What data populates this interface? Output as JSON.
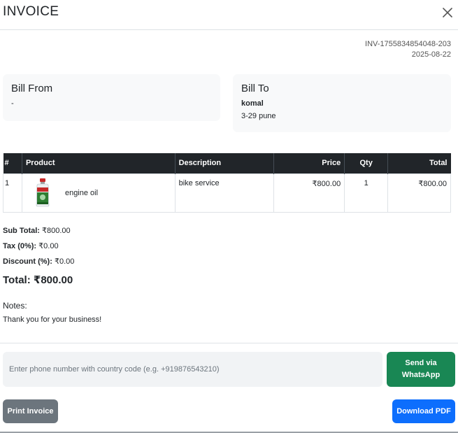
{
  "modal": {
    "title": "INVOICE",
    "close_icon": "close-icon"
  },
  "invoice": {
    "number": "INV-1755834854048-203",
    "date": "2025-08-22"
  },
  "bill_from": {
    "title": "Bill From",
    "value": "-"
  },
  "bill_to": {
    "title": "Bill To",
    "name": "komal",
    "address": "3-29 pune"
  },
  "table": {
    "headers": [
      "#",
      "Product",
      "Description",
      "Price",
      "Qty",
      "Total"
    ],
    "rows": [
      {
        "index": "1",
        "product": "engine oil",
        "product_icon": "engine-oil-bottle-image",
        "description": "bike service",
        "price": "₹800.00",
        "qty": "1",
        "total": "₹800.00"
      }
    ]
  },
  "totals": {
    "subtotal_label": "Sub Total:",
    "subtotal_value": " ₹800.00",
    "tax_label": "Tax (0%):",
    "tax_value": " ₹0.00",
    "discount_label": "Discount (%):",
    "discount_value": " ₹0.00",
    "grand_label": "Total: ₹800.00"
  },
  "notes": {
    "label": "Notes:",
    "text": "Thank you for your business!"
  },
  "whatsapp": {
    "placeholder": "Enter phone number with country code (e.g. +919876543210)",
    "button_label": "Send via WhatsApp"
  },
  "actions": {
    "print_label": "Print Invoice",
    "pdf_label": "Download PDF"
  },
  "colors": {
    "header_dark": "#212529",
    "whatsapp_green": "#198754",
    "print_gray": "#6c757d",
    "pdf_blue": "#0d6efd",
    "card_bg": "#f8f9fa"
  }
}
